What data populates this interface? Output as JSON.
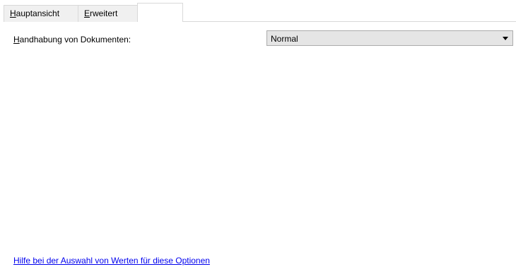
{
  "tabs": [
    {
      "label_mnemonic": "H",
      "label_rest": "auptansicht"
    },
    {
      "label_mnemonic": "E",
      "label_rest": "rweitert"
    },
    {
      "label": ""
    }
  ],
  "document_handling": {
    "label_mnemonic": "H",
    "label_rest": "andhabung von Dokumenten:",
    "selected_value": "Normal",
    "arrow_icon": "dropdown-arrow-icon"
  },
  "help_link": {
    "text": "Hilfe bei der Auswahl von Werten für diese Optionen",
    "color": "#0000ee"
  }
}
